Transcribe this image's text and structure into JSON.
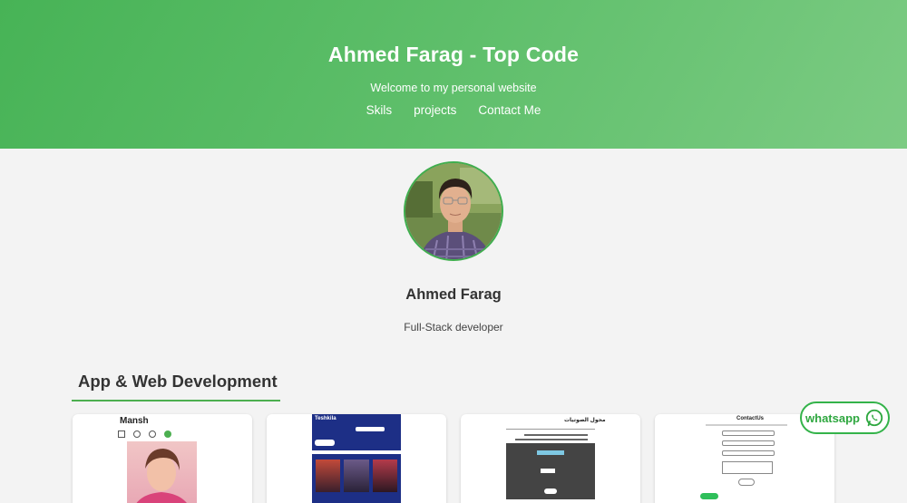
{
  "header": {
    "title": "Ahmed Farag - Top Code",
    "tagline": "Welcome to my personal website",
    "nav": [
      {
        "label": "Skils"
      },
      {
        "label": "projects"
      },
      {
        "label": "Contact Me"
      }
    ]
  },
  "profile": {
    "name": "Ahmed Farag",
    "role": "Full-Stack developer"
  },
  "section": {
    "title": "App & Web Development"
  },
  "projects": [
    {
      "preview_title": "Mansh"
    },
    {
      "preview_title": "Teshkila"
    },
    {
      "preview_title": "محول الصوتيات"
    },
    {
      "preview_title": "ContactUs"
    }
  ],
  "whatsapp": {
    "label": "whatsapp",
    "icon": "whatsapp-icon"
  },
  "colors": {
    "brand_green": "#4caf50",
    "header_gradient_start": "#47b356",
    "header_gradient_end": "#7ccb83"
  }
}
